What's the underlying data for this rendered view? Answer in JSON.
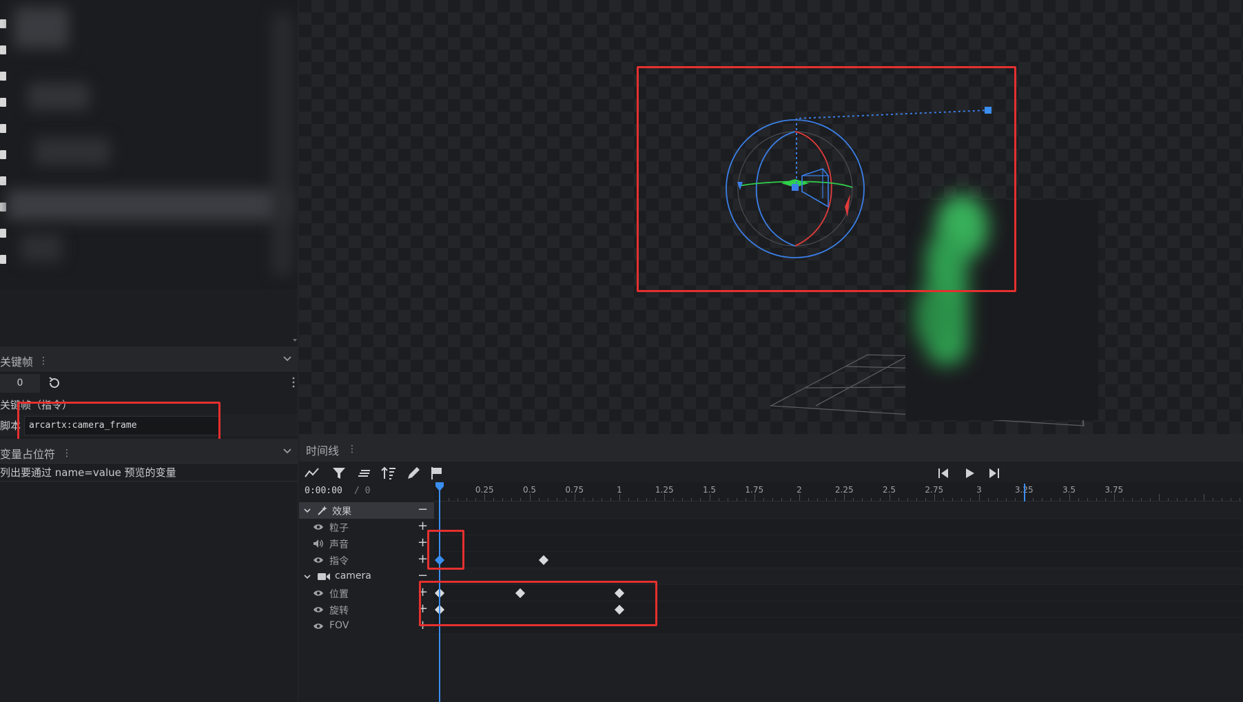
{
  "keyframes_section": {
    "title": "关键帧",
    "frame_value": "0",
    "command_label": "关键帧（指令）",
    "script_label": "脚本",
    "script_value": "arcartx:camera_frame"
  },
  "variables_section": {
    "title": "变量占位符",
    "description": "列出要通过 name=value 预览的变量"
  },
  "timeline": {
    "title": "时间线",
    "current_time": "0:00:00",
    "total_time": "/ 0",
    "ticks": [
      "0.25",
      "0.5",
      "0.75",
      "1",
      "1.25",
      "1.5",
      "1.75",
      "2",
      "2.25",
      "2.5",
      "2.75",
      "3",
      "3.25",
      "3.5",
      "3.75"
    ],
    "tracks": {
      "effects_group": "效果",
      "particles": "粒子",
      "sound": "声音",
      "command": "指令",
      "camera_group": "camera",
      "position": "位置",
      "rotation": "旋转",
      "fov": "FOV"
    },
    "keyframes": {
      "command": [
        0,
        0.58
      ],
      "position": [
        0,
        0.45,
        1
      ],
      "rotation": [
        0,
        1
      ]
    }
  },
  "colors": {
    "accent_blue": "#3a8ef0",
    "highlight_red": "#e5302f",
    "gizmo_green": "#2fd14a",
    "gizmo_red": "#e23b3b"
  }
}
